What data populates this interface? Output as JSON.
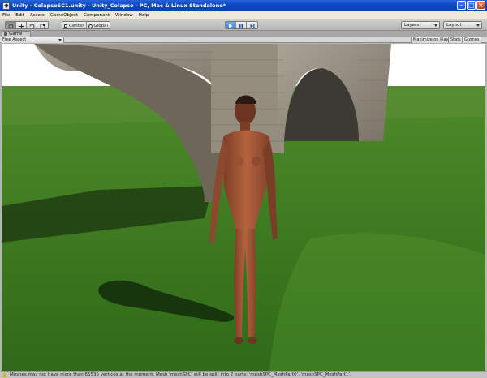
{
  "window": {
    "title": "Unity - ColapsoSC1.unity - Unity_Colapso - PC, Mac & Linux Standalone*"
  },
  "menu": [
    "File",
    "Edit",
    "Assets",
    "GameObject",
    "Component",
    "Window",
    "Help"
  ],
  "toolbar": {
    "transform_tools": [
      "hand-tool",
      "move-tool",
      "rotate-tool",
      "scale-tool"
    ],
    "pivot_label": "Center",
    "space_label": "Global",
    "layers_label": "Layers",
    "layout_label": "Layout",
    "play_state": "playing"
  },
  "game_view": {
    "tab_label": "Game",
    "aspect_label": "Free Aspect",
    "maximize_label": "Maximize on Play",
    "stats_label": "Stats",
    "gizmos_label": "Gizmos"
  },
  "status": {
    "message": "Meshes may not have more than 65535 vertices at the moment. Mesh 'meshSPC' will be split into 2 parts: 'meshSPC_MeshPart0', 'meshSPC_MeshPart1'."
  },
  "colors": {
    "sky": "#ffffff",
    "grass": "#3d7a1f",
    "stone": "#8f8878",
    "figure": "#a5583a",
    "titlebar": "#0b48c7"
  }
}
